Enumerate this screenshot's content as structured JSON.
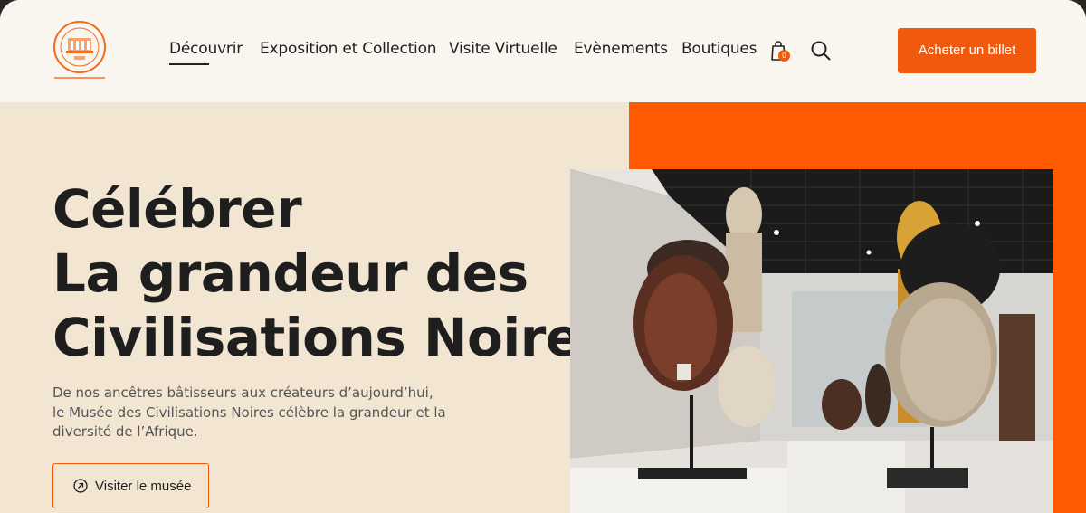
{
  "header": {
    "logo_alt": "Musée des Civilisations Noires",
    "nav": [
      {
        "label": "Découvrir",
        "active": true
      },
      {
        "label": "Exposition et Collection",
        "active": false
      },
      {
        "label": "Visite Virtuelle",
        "active": false
      },
      {
        "label": "Evènements",
        "active": false
      },
      {
        "label": "Boutiques",
        "active": false
      }
    ],
    "cart_count": "0",
    "cta_label": "Acheter un billet"
  },
  "hero": {
    "title_lines": [
      "Célébrer",
      "La grandeur des",
      "Civilisations Noires"
    ],
    "description_lines": [
      "De nos ancêtres bâtisseurs aux créateurs d’aujourd’hui,",
      "le Musée des Civilisations Noires célèbre la grandeur et la",
      "diversité de l’Afrique."
    ],
    "button_label": "Visiter le musée"
  },
  "icons": {
    "cart": "shopping-bag-icon",
    "search": "search-icon",
    "arrow": "arrow-up-right-circle-icon"
  },
  "colors": {
    "accent": "#f15a0c",
    "hero_background": "#f2e6d3",
    "header_background": "#f9f6f0",
    "text": "#1e1e1e"
  }
}
